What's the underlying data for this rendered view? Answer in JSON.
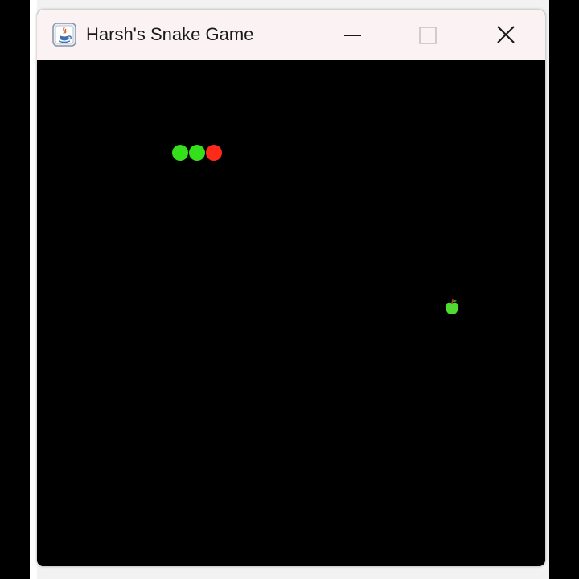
{
  "window": {
    "title": "Harsh's Snake Game",
    "controls": {
      "minimize": "minimize-icon",
      "maximize": "maximize-icon",
      "close": "close-icon"
    }
  },
  "game": {
    "board_color": "#000000",
    "snake": {
      "head_color": "#ff2a1a",
      "body_color": "#33e01a",
      "length": 3
    },
    "apple": {
      "icon": "apple-icon",
      "color": "#4fdc2e"
    }
  }
}
